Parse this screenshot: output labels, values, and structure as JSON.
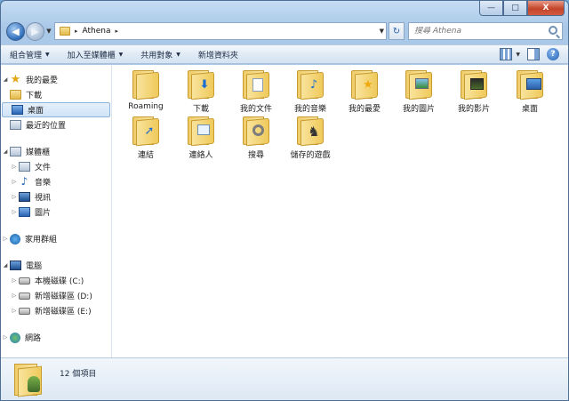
{
  "window": {
    "min_label": "—",
    "max_label": "□",
    "close_label": "X"
  },
  "nav": {
    "back_glyph": "◀",
    "forward_glyph": "▶",
    "address_separator": "▸",
    "address_path": "Athena",
    "dropdown_glyph": "▼",
    "refresh_glyph": "↻",
    "search_placeholder": "搜尋 Athena"
  },
  "toolbar": {
    "items": [
      "組合管理",
      "加入至媒體櫃",
      "共用對象",
      "新增資料夾"
    ],
    "caret": "▼",
    "help_label": "?"
  },
  "sidebar": {
    "favorites": {
      "label": "我的最愛",
      "items": [
        "下載",
        "桌面",
        "最近的位置"
      ]
    },
    "libraries": {
      "label": "媒體櫃",
      "items": [
        "文件",
        "音樂",
        "視訊",
        "圖片"
      ]
    },
    "homegroup": {
      "label": "家用群組"
    },
    "computer": {
      "label": "電腦",
      "items": [
        "本機磁碟 (C:)",
        "新增磁碟區 (D:)",
        "新增磁碟區 (E:)"
      ]
    },
    "network": {
      "label": "網路"
    },
    "expand_open": "◢",
    "expand_closed": "▷"
  },
  "main": {
    "items": [
      {
        "label": "Roaming",
        "icon": "folder-icon"
      },
      {
        "label": "下載",
        "icon": "downloads-folder-icon"
      },
      {
        "label": "我的文件",
        "icon": "documents-folder-icon"
      },
      {
        "label": "我的音樂",
        "icon": "music-folder-icon"
      },
      {
        "label": "我的最愛",
        "icon": "favorites-folder-icon"
      },
      {
        "label": "我的圖片",
        "icon": "pictures-folder-icon"
      },
      {
        "label": "我的影片",
        "icon": "videos-folder-icon"
      },
      {
        "label": "桌面",
        "icon": "desktop-folder-icon"
      },
      {
        "label": "連結",
        "icon": "links-folder-icon"
      },
      {
        "label": "連絡人",
        "icon": "contacts-folder-icon"
      },
      {
        "label": "搜尋",
        "icon": "searches-folder-icon"
      },
      {
        "label": "儲存的遊戲",
        "icon": "saved-games-folder-icon"
      }
    ]
  },
  "status": {
    "text": "12 個項目"
  }
}
